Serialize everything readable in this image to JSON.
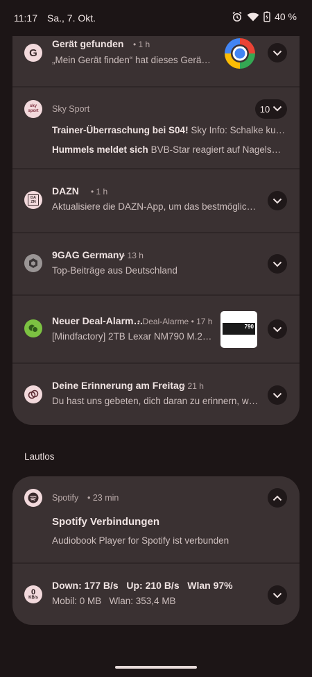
{
  "status_bar": {
    "time": "11:17",
    "date": "Sa., 7. Okt.",
    "battery": "40 %"
  },
  "notifications": [
    {
      "app": "Google",
      "title": "Gerät gefunden",
      "time": "1 h",
      "body": "„Mein Gerät finden“ hat dieses Gerät …",
      "icon": "google-g-icon"
    },
    {
      "app": "Sky Sport",
      "count": "10",
      "lines": [
        {
          "bold": "Trainer-Überraschung bei S04!",
          "text": "Sky Info: Schalke kurz v…"
        },
        {
          "bold": "Hummels meldet sich",
          "text": "BVB-Star reagiert auf Nagelsman…"
        }
      ],
      "icon_text": "sky sport"
    },
    {
      "app": "DAZN",
      "title": "DAZN",
      "time": "1 h",
      "body": "Aktualisiere die DAZN-App, um das bestmöglich…",
      "icon_text": "DA ZN"
    },
    {
      "app": "9GAG",
      "title": "9GAG Germany",
      "time": "13 h",
      "body": "Top-Beiträge aus Deutschland",
      "icon": "9gag-icon"
    },
    {
      "app": "Deal",
      "title": "Neuer Deal-Alarm…",
      "channel": "Deal-Alarme",
      "time": "17 h",
      "body": "[Mindfactory] 2TB Lexar NM790 M.2 …",
      "thumb_text": "790",
      "icon": "deal-icon"
    },
    {
      "app": "Reminder",
      "title": "Deine Erinnerung am Freitag",
      "time": "21 h",
      "body": "Du hast uns gebeten, dich daran zu erinnern, wel…",
      "icon": "reminder-icon"
    }
  ],
  "silent_label": "Lautlos",
  "silent": [
    {
      "app": "Spotify",
      "time": "23 min",
      "title": "Spotify Verbindungen",
      "body": "Audiobook Player for Spotify ist verbunden"
    },
    {
      "title": "Down: 177 B/s   Up: 210 B/s   Wlan 97%",
      "body": "Mobil: 0 MB   Wlan: 353,4 MB",
      "icon_num": "0",
      "icon_unit": "KB/s"
    }
  ],
  "colors": {
    "background": "#1c1516",
    "card": "#3a3132",
    "icon_bg": "#f2d9dc"
  }
}
